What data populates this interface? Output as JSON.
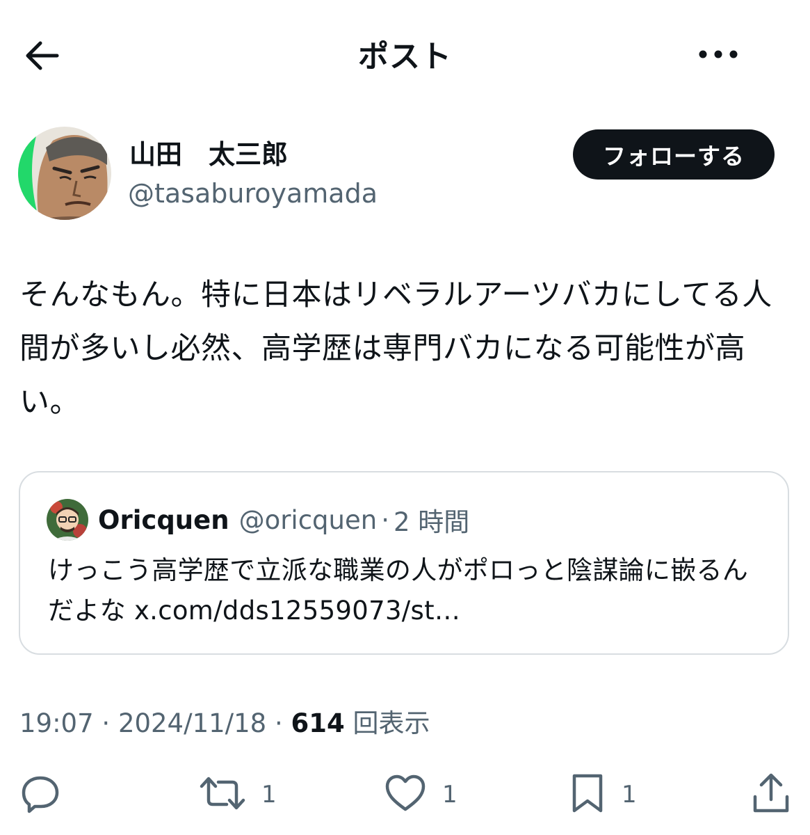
{
  "header": {
    "title": "ポスト",
    "back_icon": "arrow-left-icon",
    "more_icon": "more-horizontal-icon"
  },
  "author": {
    "display_name": "山田　太三郎",
    "handle": "@tasaburoyamada",
    "follow_label": "フォローする"
  },
  "post": {
    "text": "そんなもん。特に日本はリベラルアーツバカにしてる人間が多いし必然、高学歴は専門バカになる可能性が高い。"
  },
  "quote": {
    "name": "Oricquen",
    "handle": "@oricquen",
    "separator": "·",
    "time": "2 時間",
    "text": "けっこう高学歴で立派な職業の人がポロっと陰謀論に嵌るんだよな x.com/dds12559073/st…"
  },
  "meta": {
    "time": "19:07",
    "separator": " · ",
    "date": "2024/11/18",
    "views_count": "614",
    "views_label": " 回表示"
  },
  "actions": {
    "reply": {
      "icon": "reply-icon",
      "count": ""
    },
    "repost": {
      "icon": "repost-icon",
      "count": "1"
    },
    "like": {
      "icon": "heart-icon",
      "count": "1"
    },
    "bookmark": {
      "icon": "bookmark-icon",
      "count": "1"
    },
    "share": {
      "icon": "share-icon"
    }
  },
  "colors": {
    "text_primary": "#0f1419",
    "text_secondary": "#536471",
    "border": "#d8dde1",
    "follow_bg": "#0f1419",
    "avatar_accent": "#22d86a"
  }
}
